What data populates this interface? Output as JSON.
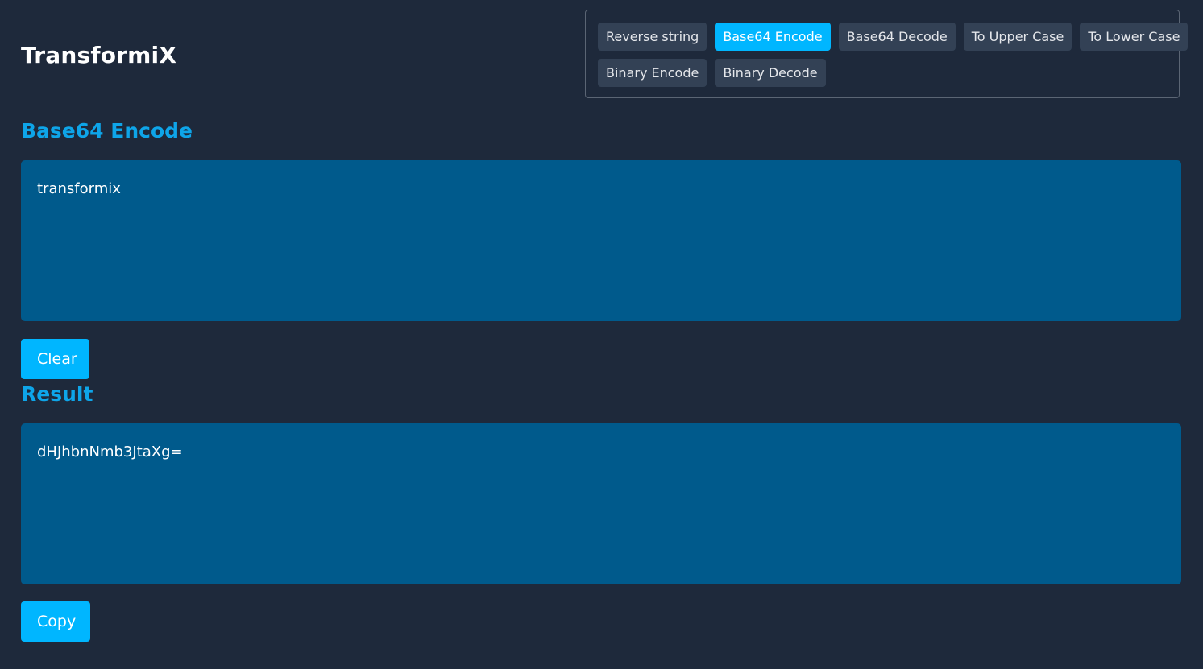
{
  "app": {
    "title": "TransformiX"
  },
  "nav": {
    "row1": [
      {
        "label": "Reverse string",
        "active": false
      },
      {
        "label": "Base64 Encode",
        "active": true
      },
      {
        "label": "Base64 Decode",
        "active": false
      },
      {
        "label": "To Upper Case",
        "active": false
      },
      {
        "label": "To Lower Case",
        "active": false
      }
    ],
    "row2": [
      {
        "label": "Binary Encode",
        "active": false
      },
      {
        "label": "Binary Decode",
        "active": false
      }
    ]
  },
  "input_section": {
    "title": "Base64 Encode",
    "value": "transformix",
    "clear_label": "Clear"
  },
  "result_section": {
    "title": "Result",
    "value": "dHJhbnNmb3JtaXg=",
    "copy_label": "Copy"
  },
  "colors": {
    "background": "#1e293b",
    "accent": "#00b6ff",
    "heading": "#0ea5e9",
    "textarea": "#005a8c",
    "nav_button": "#334155"
  }
}
